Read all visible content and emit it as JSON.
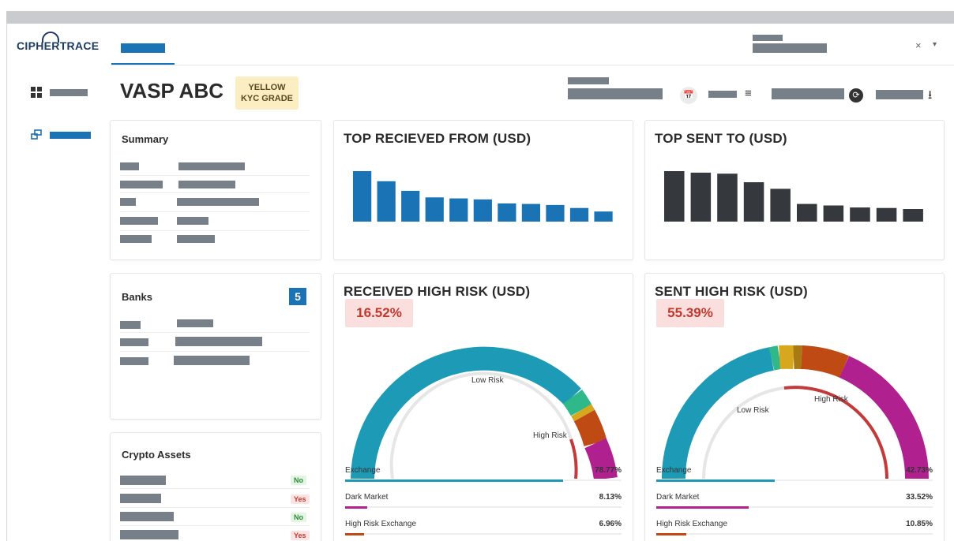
{
  "app": {
    "logo": "CIPHERTRACE"
  },
  "header": {
    "close_label": "×",
    "caret_label": "▾"
  },
  "page": {
    "title": "VASP ABC",
    "kyc_badge": {
      "line1": "YELLOW",
      "line2": "KYC GRADE",
      "color": "#fbeec2"
    }
  },
  "toolbar": {
    "calendar_icon": "📅",
    "filter_icon": "≡",
    "refresh_icon": "⟳",
    "download_icon": "⭳"
  },
  "summary": {
    "title": "Summary"
  },
  "banks": {
    "title": "Banks",
    "count": "5"
  },
  "crypto_assets": {
    "title": "Crypto Assets",
    "rows": [
      {
        "status": "No"
      },
      {
        "status": "Yes"
      },
      {
        "status": "No"
      },
      {
        "status": "Yes"
      }
    ]
  },
  "top_received": {
    "title": "TOP RECIEVED FROM (USD)",
    "color": "#1a73b5",
    "chart_data": {
      "type": "bar",
      "values": [
        100,
        80,
        61,
        48,
        46,
        44,
        36,
        35,
        33,
        27,
        20
      ]
    }
  },
  "top_sent": {
    "title": "TOP SENT TO (USD)",
    "color": "#35393e",
    "chart_data": {
      "type": "bar",
      "values": [
        100,
        97,
        95,
        78,
        65,
        35,
        32,
        28,
        27,
        25
      ]
    }
  },
  "received_high_risk": {
    "title": "RECEIVED HIGH RISK (USD)",
    "percent": "16.52%",
    "low_label": "Low Risk",
    "high_label": "High Risk",
    "legend": [
      {
        "name": "Exchange",
        "value": "78.77%",
        "fraction": 0.7877,
        "color": "#1d9bb6"
      },
      {
        "name": "Dark Market",
        "value": "8.13%",
        "fraction": 0.0813,
        "color": "#b0208f"
      },
      {
        "name": "High Risk Exchange",
        "value": "6.96%",
        "fraction": 0.0696,
        "color": "#c04a14"
      }
    ]
  },
  "sent_high_risk": {
    "title": "SENT HIGH RISK (USD)",
    "percent": "55.39%",
    "low_label": "Low Risk",
    "high_label": "High Risk",
    "legend": [
      {
        "name": "Exchange",
        "value": "42.73%",
        "fraction": 0.4273,
        "color": "#1d9bb6"
      },
      {
        "name": "Dark Market",
        "value": "33.52%",
        "fraction": 0.3352,
        "color": "#b0208f"
      },
      {
        "name": "High Risk Exchange",
        "value": "10.85%",
        "fraction": 0.1085,
        "color": "#c04a14"
      }
    ]
  }
}
